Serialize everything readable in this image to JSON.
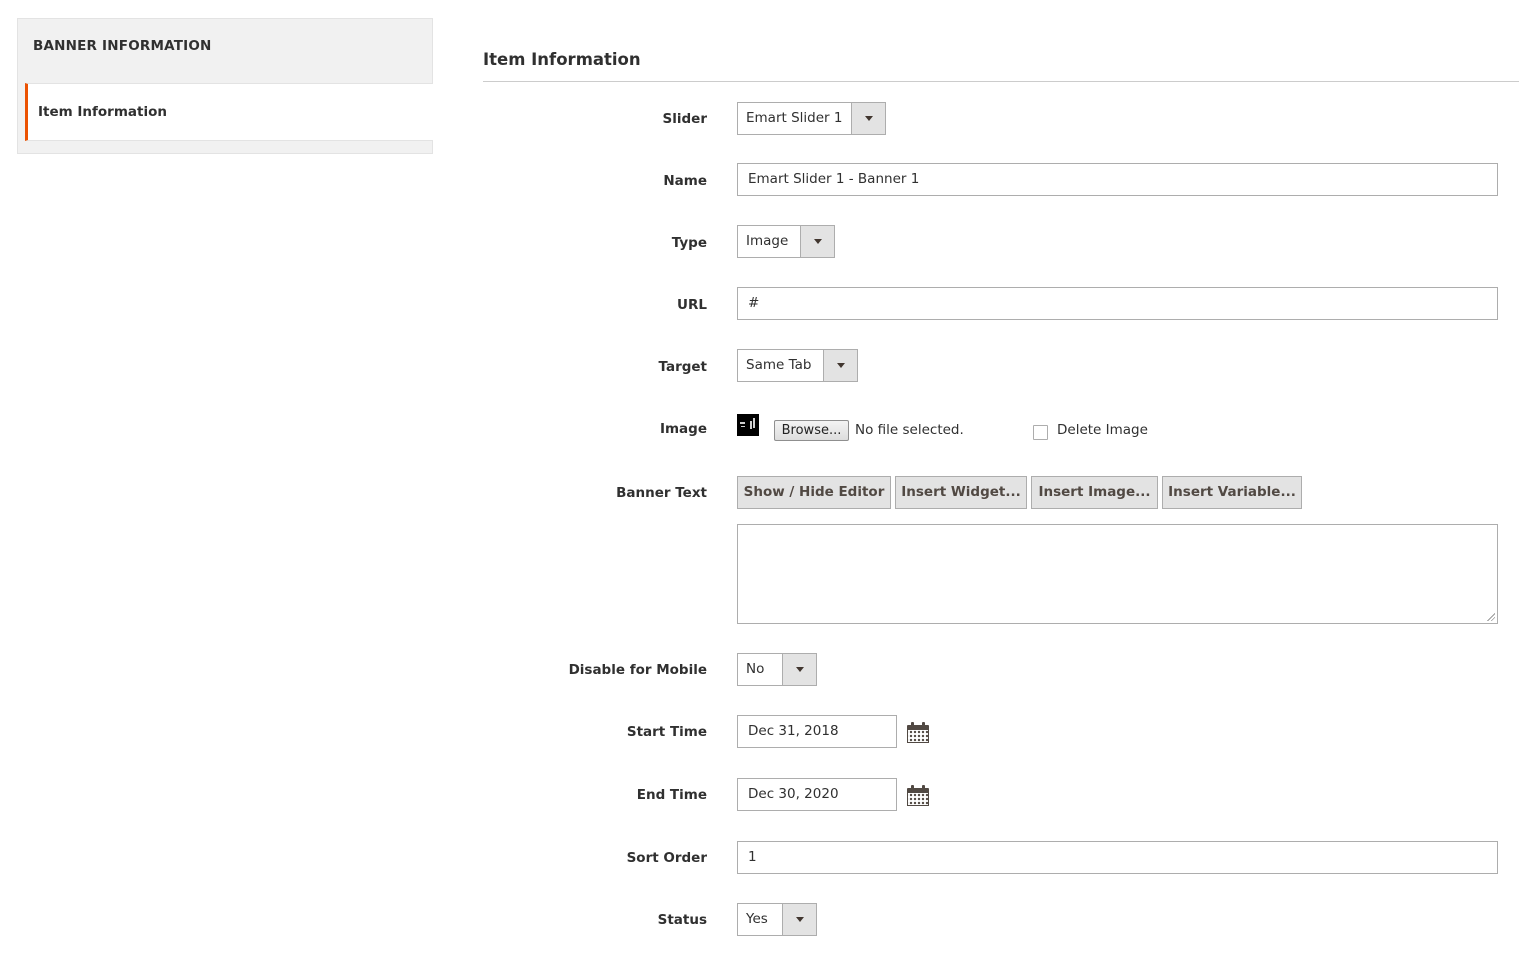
{
  "sidebar": {
    "title": "BANNER INFORMATION",
    "tab_label": "Item Information"
  },
  "section": {
    "title": "Item Information"
  },
  "form": {
    "slider": {
      "label": "Slider",
      "value": "Emart Slider 1"
    },
    "name": {
      "label": "Name",
      "value": "Emart Slider 1 - Banner 1"
    },
    "type": {
      "label": "Type",
      "value": "Image"
    },
    "url": {
      "label": "URL",
      "value": "#"
    },
    "target": {
      "label": "Target",
      "value": "Same Tab"
    },
    "image": {
      "label": "Image",
      "browse_label": "Browse...",
      "no_file_text": "No file selected.",
      "delete_label": "Delete Image",
      "delete_checked": false
    },
    "banner_text": {
      "label": "Banner Text",
      "buttons": [
        "Show / Hide Editor",
        "Insert Widget...",
        "Insert Image...",
        "Insert Variable..."
      ],
      "value": ""
    },
    "disable_mobile": {
      "label": "Disable for Mobile",
      "value": "No"
    },
    "start_time": {
      "label": "Start Time",
      "value": "Dec 31, 2018",
      "icon": "calendar-icon"
    },
    "end_time": {
      "label": "End Time",
      "value": "Dec 30, 2020",
      "icon": "calendar-icon"
    },
    "sort_order": {
      "label": "Sort Order",
      "value": "1"
    },
    "status": {
      "label": "Status",
      "value": "Yes"
    }
  },
  "colors": {
    "accent": "#eb5202",
    "button_bg": "#e3e3e3",
    "border": "#adadad",
    "text": "#303030"
  }
}
